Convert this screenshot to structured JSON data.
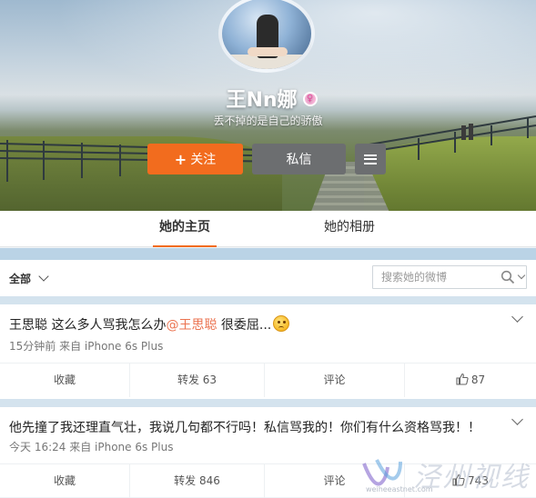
{
  "profile": {
    "name": "王Nn娜",
    "bio": "丢不掉的是自己的骄傲",
    "gender_icon": "female-icon"
  },
  "buttons": {
    "follow_label": "关注",
    "follow_icon": "plus-icon",
    "message_label": "私信",
    "more_icon": "menu-icon"
  },
  "colors": {
    "accent": "#f26c1e",
    "mention": "#eb7350",
    "button_gray": "#6c6e70"
  },
  "tabs": [
    {
      "label": "她的主页",
      "active": true
    },
    {
      "label": "她的相册",
      "active": false
    }
  ],
  "filter": {
    "label": "全部",
    "search_placeholder": "搜索她的微博"
  },
  "posts": [
    {
      "author": "王思聪",
      "text_before": " 这么多人骂我怎么办",
      "mention": "@王思聪",
      "text_after": " 很委屈...",
      "emoji": "sad-emoji",
      "meta": "15分钟前 来自 iPhone 6s Plus",
      "actions": {
        "favorite": "收藏",
        "forward": "转发 63",
        "comment": "评论",
        "likes": "87"
      }
    },
    {
      "text": "他先撞了我还理直气壮，我说几句都不行吗！私信骂我的！你们有什么资格骂我！！",
      "meta": "今天 16:24 来自 iPhone 6s Plus",
      "actions": {
        "favorite": "收藏",
        "forward": "转发 846",
        "comment": "评论",
        "likes": "743"
      }
    }
  ],
  "watermark": {
    "chars": "泾州视线",
    "url": "weiheeastnet.com"
  }
}
